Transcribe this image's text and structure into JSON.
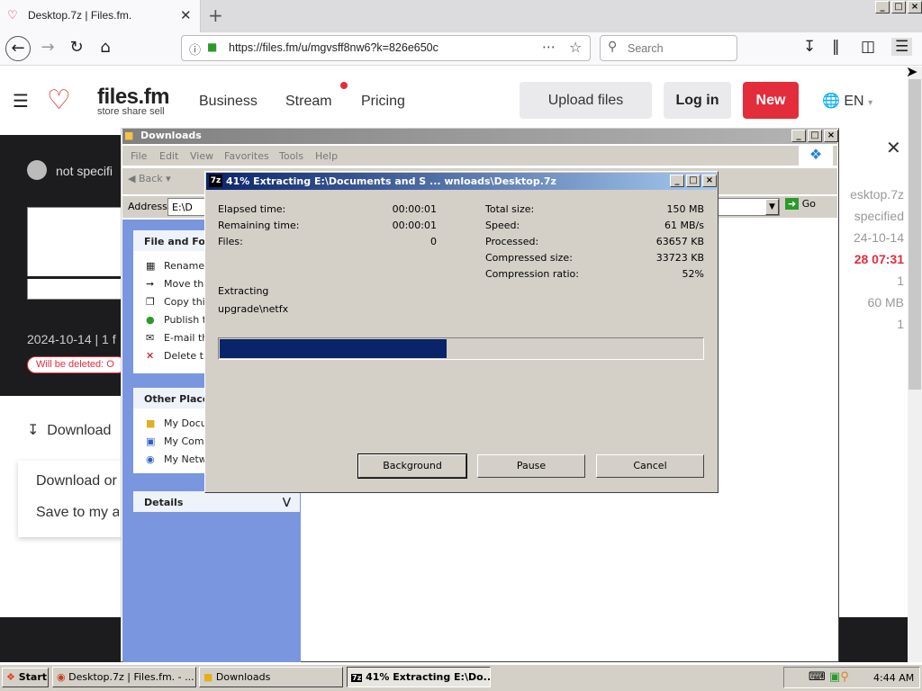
{
  "browser": {
    "tab_title": "Desktop.7z | Files.fm.",
    "url": "https://files.fm/u/mgvsff8nw6?k=826e650c",
    "search_placeholder": "Search"
  },
  "site": {
    "logo": "files.fm",
    "tagline": "store share sell",
    "nav": [
      "Business",
      "Stream",
      "Pricing"
    ],
    "upload_label": "Upload files",
    "login_label": "Log in",
    "new_label": "New",
    "lang": "EN",
    "owner": "not specifi",
    "meta": "2024-10-14 | 1 f",
    "delete_badge": "Will be deleted: O",
    "download_label": "Download",
    "download_options": [
      "Download or",
      "Save to my a"
    ],
    "right_values": [
      "esktop.7z",
      "specified",
      "24-10-14",
      "28 07:31",
      "1",
      "60 MB",
      "1"
    ]
  },
  "explorer": {
    "title": "Downloads",
    "menu": [
      "File",
      "Edit",
      "View",
      "Favorites",
      "Tools",
      "Help"
    ],
    "back_label": "Back",
    "address_label": "Address",
    "address_value": "E:\\D",
    "go_label": "Go",
    "tasks_header": "File and Fold",
    "tasks": [
      "Rename",
      "Move this",
      "Copy this",
      "Publish th",
      "E-mail thi",
      "Delete th"
    ],
    "other_header": "Other Place",
    "other_places": [
      "My Docu",
      "My Comp",
      "My Netw"
    ],
    "details_header": "Details"
  },
  "dialog": {
    "title": "41% Extracting E:\\Documents and S ... wnloads\\Desktop.7z",
    "elapsed_label": "Elapsed time:",
    "elapsed": "00:00:01",
    "remaining_label": "Remaining time:",
    "remaining": "00:00:01",
    "files_label": "Files:",
    "files": "0",
    "total_label": "Total size:",
    "total": "150 MB",
    "speed_label": "Speed:",
    "speed": "61 MB/s",
    "processed_label": "Processed:",
    "processed": "63657 KB",
    "compressed_label": "Compressed size:",
    "compressed": "33723 KB",
    "ratio_label": "Compression ratio:",
    "ratio": "52%",
    "status": "Extracting",
    "current_file": "upgrade\\netfx",
    "progress": 0.47,
    "background_label": "Background",
    "pause_label": "Pause",
    "cancel_label": "Cancel"
  },
  "taskbar": {
    "start_label": "Start",
    "items": [
      "Desktop.7z | Files.fm. - ...",
      "Downloads",
      "41% Extracting E:\\Do..."
    ],
    "clock": "4:44 AM"
  }
}
